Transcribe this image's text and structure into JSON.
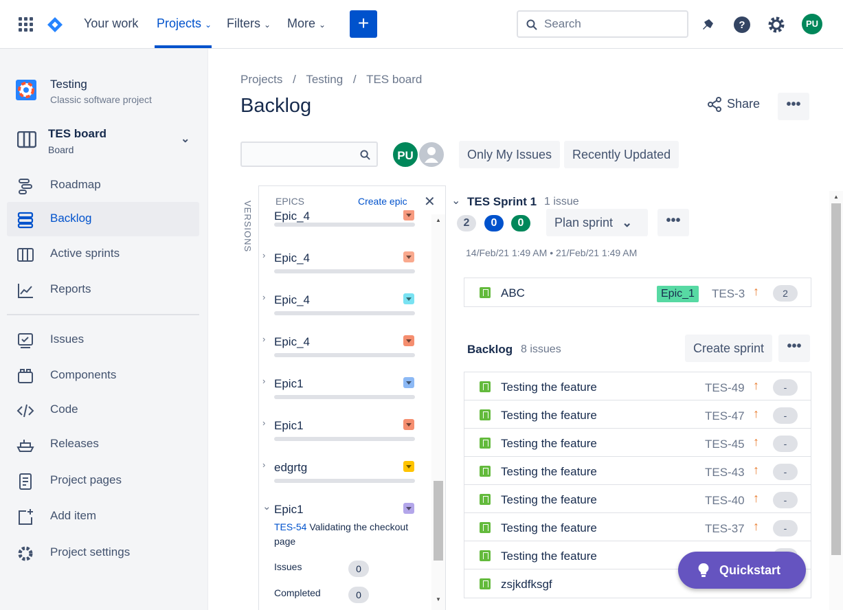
{
  "nav": {
    "your_work": "Your work",
    "projects": "Projects",
    "filters": "Filters",
    "more": "More",
    "create": "+",
    "search_placeholder": "Search",
    "avatar": "PU"
  },
  "colors": {
    "primary": "#0052cc",
    "story": "#63ba3c",
    "priority": "#e97f33",
    "quickstart": "#6554c0"
  },
  "sidebar": {
    "project_name": "Testing",
    "project_type": "Classic software project",
    "board_name": "TES board",
    "board_type": "Board",
    "items": [
      {
        "label": "Roadmap",
        "icon": "roadmap-icon"
      },
      {
        "label": "Backlog",
        "icon": "backlog-icon"
      },
      {
        "label": "Active sprints",
        "icon": "active-sprints-icon"
      },
      {
        "label": "Reports",
        "icon": "reports-icon"
      },
      {
        "label": "Issues",
        "icon": "issues-icon"
      },
      {
        "label": "Components",
        "icon": "components-icon"
      },
      {
        "label": "Code",
        "icon": "code-icon"
      },
      {
        "label": "Releases",
        "icon": "releases-icon"
      },
      {
        "label": "Project pages",
        "icon": "project-pages-icon"
      },
      {
        "label": "Add item",
        "icon": "add-item-icon"
      },
      {
        "label": "Project settings",
        "icon": "settings-icon"
      }
    ]
  },
  "breadcrumb": {
    "projects": "Projects",
    "project": "Testing",
    "board": "TES board",
    "sep": "/"
  },
  "page": {
    "title": "Backlog",
    "share": "Share",
    "more": "•••"
  },
  "filters": {
    "avatar": "PU",
    "only_my": "Only My Issues",
    "recent": "Recently Updated"
  },
  "epics_panel": {
    "versions": "VERSIONS",
    "header": "EPICS",
    "create": "Create epic",
    "close": "✕",
    "epics": [
      {
        "name": "Epic_4",
        "color": "#f79a7f"
      },
      {
        "name": "Epic_4",
        "color": "#f9a98e"
      },
      {
        "name": "Epic_4",
        "color": "#79e2f2"
      },
      {
        "name": "Epic_4",
        "color": "#f58e6f"
      },
      {
        "name": "Epic1",
        "color": "#8cb9f5"
      },
      {
        "name": "Epic1",
        "color": "#f58e6f"
      },
      {
        "name": "edgrtg",
        "color": "#ffc400"
      },
      {
        "name": "Epic1",
        "color": "#b3a6ea"
      }
    ],
    "expanded": {
      "key": "TES-54",
      "summary": "Validating the checkout page",
      "issues_label": "Issues",
      "issues": "0",
      "completed_label": "Completed",
      "completed": "0"
    }
  },
  "sprint": {
    "name": "TES Sprint 1",
    "count": "1 issue",
    "pills": [
      "2",
      "0",
      "0"
    ],
    "plan": "Plan sprint",
    "more": "•••",
    "dates": "14/Feb/21 1:49 AM • 21/Feb/21 1:49 AM",
    "issues": [
      {
        "summary": "ABC",
        "epic": "Epic_1",
        "key": "TES-3",
        "priority": "↑",
        "estimate": "2"
      }
    ]
  },
  "backlog": {
    "name": "Backlog",
    "count": "8 issues",
    "create_sprint": "Create sprint",
    "more": "•••",
    "issues": [
      {
        "summary": "Testing the feature",
        "key": "TES-49",
        "priority": "↑",
        "estimate": "-"
      },
      {
        "summary": "Testing the feature",
        "key": "TES-47",
        "priority": "↑",
        "estimate": "-"
      },
      {
        "summary": "Testing the feature",
        "key": "TES-45",
        "priority": "↑",
        "estimate": "-"
      },
      {
        "summary": "Testing the feature",
        "key": "TES-43",
        "priority": "↑",
        "estimate": "-"
      },
      {
        "summary": "Testing the feature",
        "key": "TES-40",
        "priority": "↑",
        "estimate": "-"
      },
      {
        "summary": "Testing the feature",
        "key": "TES-37",
        "priority": "↑",
        "estimate": "-"
      },
      {
        "summary": "Testing the feature",
        "key": "",
        "priority": "↑",
        "estimate": "-"
      },
      {
        "summary": "zsjkdfksgf",
        "key": "",
        "priority": "",
        "estimate": ""
      }
    ]
  },
  "quickstart": {
    "label": "Quickstart"
  }
}
